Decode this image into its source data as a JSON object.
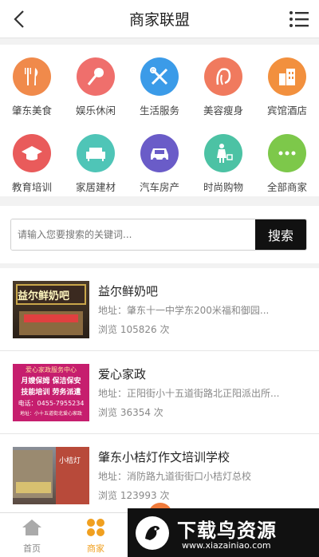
{
  "header": {
    "title": "商家联盟"
  },
  "categories": [
    {
      "label": "肇东美食",
      "icon": "cutlery-icon",
      "color": "#f08a4b"
    },
    {
      "label": "娱乐休闲",
      "icon": "microphone-icon",
      "color": "#ef6f6c"
    },
    {
      "label": "生活服务",
      "icon": "tools-icon",
      "color": "#3b9be8"
    },
    {
      "label": "美容瘦身",
      "icon": "face-icon",
      "color": "#f07a5e"
    },
    {
      "label": "宾馆酒店",
      "icon": "building-icon",
      "color": "#f2903e"
    },
    {
      "label": "教育培训",
      "icon": "graduation-cap-icon",
      "color": "#e95b5b"
    },
    {
      "label": "家居建材",
      "icon": "sofa-icon",
      "color": "#4fc5b7"
    },
    {
      "label": "汽车房产",
      "icon": "car-icon",
      "color": "#6a5cc8"
    },
    {
      "label": "时尚购物",
      "icon": "shopping-icon",
      "color": "#4cc2a4"
    },
    {
      "label": "全部商家",
      "icon": "more-icon",
      "color": "#7dc84a"
    }
  ],
  "search": {
    "placeholder": "请输入您要搜索的关键词...",
    "button": "搜索"
  },
  "merchants": [
    {
      "name": "益尔鲜奶吧",
      "address": "地址：肇东十一中学东200米福和御园...",
      "views": "浏览 105826 次",
      "thumb_text": "益尔鲜奶吧"
    },
    {
      "name": "爱心家政",
      "address": "地址：正阳街小十五道街路北正阳派出所...",
      "views": "浏览 36354 次",
      "thumb_lines": [
        "爱心家政服务中心",
        "月嫂保姆  保洁保安",
        "技能培训  劳务派遣",
        "电话：0455-7955234",
        "地址：小十五道街北爱心家政"
      ]
    },
    {
      "name": "肇东小桔灯作文培训学校",
      "address": "地址：消防路九道街街口小桔灯总校",
      "views": "浏览 123993 次",
      "thumb_text": "小桔灯"
    }
  ],
  "tabs": [
    {
      "label": "首页",
      "icon": "home-icon"
    },
    {
      "label": "商家",
      "icon": "merchant-icon"
    }
  ],
  "banner": {
    "name": "下载鸟资源",
    "url": "www.xiazainiao.com"
  }
}
